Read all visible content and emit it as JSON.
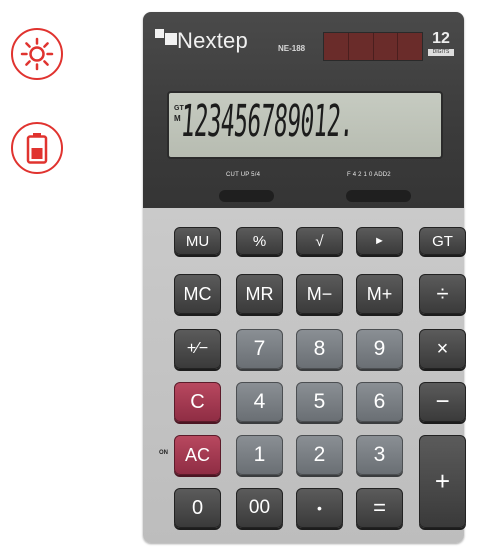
{
  "features": [
    {
      "icon": "sun-icon",
      "color": "#e0332f"
    },
    {
      "icon": "battery-icon",
      "color": "#e0332f"
    }
  ],
  "calculator": {
    "brand": "Nextep",
    "model": "NE-188",
    "digits_badge": {
      "number": "12",
      "label": "DIGITS"
    },
    "display": {
      "indicator_gt": "GT",
      "indicator_m": "M",
      "value": "123456789012."
    },
    "switches": {
      "left_label": "CUT UP 5/4",
      "right_label": "F 4 2 1 0 ADD2"
    },
    "on_label": "ON",
    "keys": [
      {
        "id": "mu",
        "label": "MU"
      },
      {
        "id": "percent",
        "label": "%"
      },
      {
        "id": "sqrt",
        "label": "√"
      },
      {
        "id": "right-arrow",
        "label": "►"
      },
      {
        "id": "gt",
        "label": "GT"
      },
      {
        "id": "mc",
        "label": "MC"
      },
      {
        "id": "mr",
        "label": "MR"
      },
      {
        "id": "m-minus",
        "label": "M−"
      },
      {
        "id": "m-plus",
        "label": "M+"
      },
      {
        "id": "divide",
        "label": "÷"
      },
      {
        "id": "plus-minus",
        "label": "+⁄−"
      },
      {
        "id": "seven",
        "label": "7"
      },
      {
        "id": "eight",
        "label": "8"
      },
      {
        "id": "nine",
        "label": "9"
      },
      {
        "id": "multiply",
        "label": "×"
      },
      {
        "id": "c",
        "label": "C"
      },
      {
        "id": "four",
        "label": "4"
      },
      {
        "id": "five",
        "label": "5"
      },
      {
        "id": "six",
        "label": "6"
      },
      {
        "id": "minus",
        "label": "−"
      },
      {
        "id": "ac",
        "label": "AC"
      },
      {
        "id": "one",
        "label": "1"
      },
      {
        "id": "two",
        "label": "2"
      },
      {
        "id": "three",
        "label": "3"
      },
      {
        "id": "plus",
        "label": "+"
      },
      {
        "id": "zero",
        "label": "0"
      },
      {
        "id": "double-zero",
        "label": "00"
      },
      {
        "id": "decimal",
        "label": "•"
      },
      {
        "id": "equals",
        "label": "="
      }
    ]
  }
}
